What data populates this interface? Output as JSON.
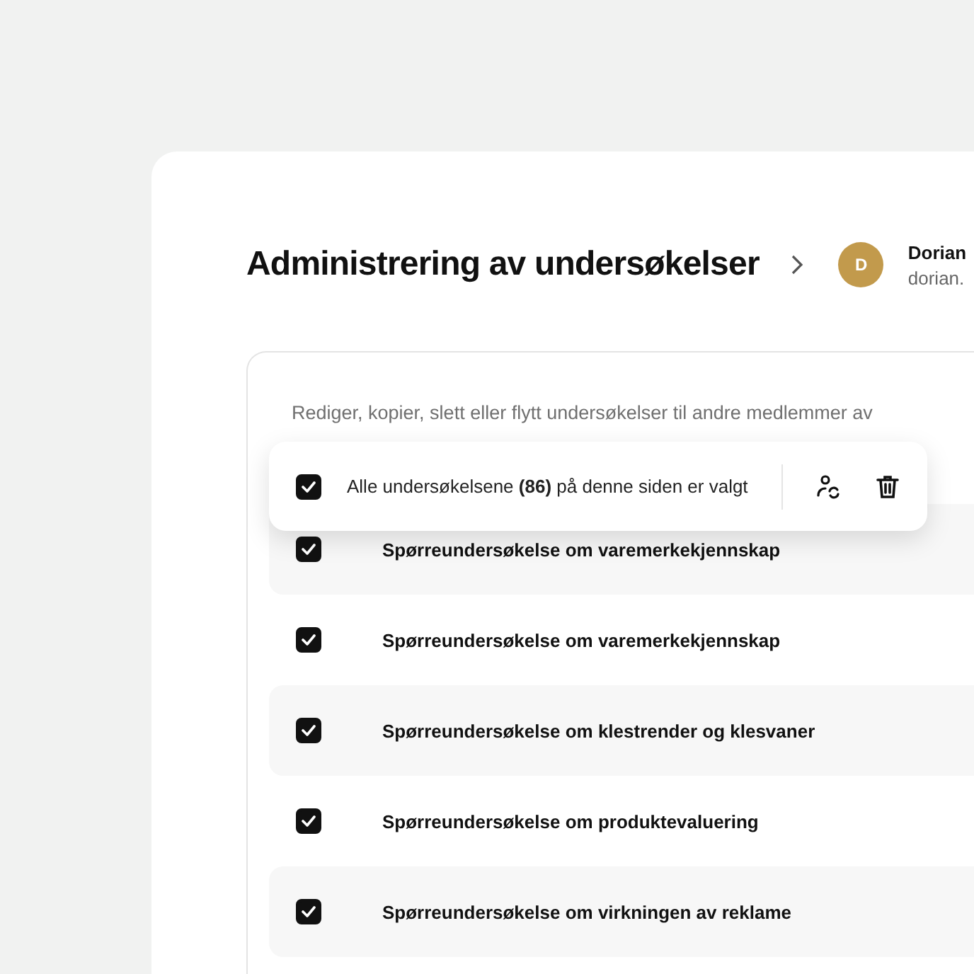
{
  "header": {
    "title": "Administrering av undersøkelser",
    "user": {
      "initial": "D",
      "name": "Dorian",
      "email": "dorian."
    }
  },
  "description": "Rediger, kopier, slett eller flytt undersøkelser til andre medlemmer av",
  "selection_bar": {
    "checked": true,
    "text": "Alle undersøkelsene **(86)** på denne siden er valgt"
  },
  "surveys": [
    {
      "title": "Spørreundersøkelse om varemerkekjennskap",
      "checked": true
    },
    {
      "title": "Spørreundersøkelse om varemerkekjennskap",
      "checked": true
    },
    {
      "title": "Spørreundersøkelse om klestrender og klesvaner",
      "checked": true
    },
    {
      "title": "Spørreundersøkelse om produktevaluering",
      "checked": true
    },
    {
      "title": "Spørreundersøkelse om virkningen av reklame",
      "checked": true
    }
  ]
}
